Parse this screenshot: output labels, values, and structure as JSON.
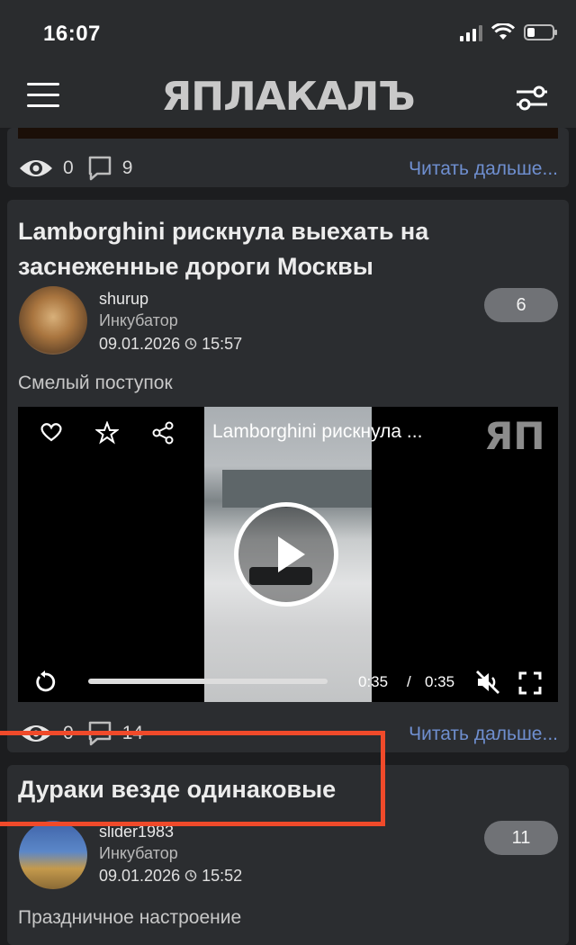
{
  "status_bar": {
    "time": "16:07"
  },
  "header": {
    "logo": "ЯПЛАКАЛЪ"
  },
  "post0": {
    "views": "0",
    "comments": "9",
    "read_more": "Читать дальше..."
  },
  "post1": {
    "title": "Lamborghini рискнула выехать на заснеженные дороги Москвы",
    "author": "shurup",
    "group": "Инкубатор",
    "date": "09.01.2026",
    "time": "15:57",
    "rating": "6",
    "lead": "Смелый поступок",
    "video": {
      "title": "Lamborghini рискнула ...",
      "watermark": "ЯП",
      "current_time": "0:35",
      "separator": "/",
      "duration": "0:35"
    },
    "views": "0",
    "comments": "14",
    "read_more": "Читать дальше..."
  },
  "post2": {
    "title": "Дураки везде одинаковые",
    "author": "slider1983",
    "group": "Инкубатор",
    "date": "09.01.2026",
    "time": "15:52",
    "rating": "11",
    "lead": "Праздничное настроение"
  },
  "colors": {
    "link": "#6f8fd0",
    "highlight": "#f04a2a",
    "card": "#2b2d30"
  }
}
